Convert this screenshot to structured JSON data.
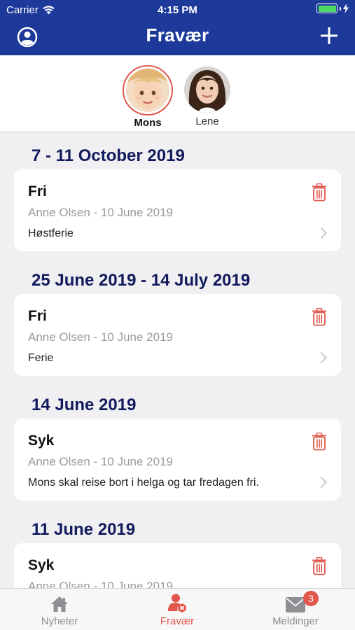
{
  "status_bar": {
    "carrier": "Carrier",
    "time": "4:15 PM"
  },
  "nav": {
    "title": "Fravær"
  },
  "children": [
    {
      "name": "Mons",
      "selected": true
    },
    {
      "name": "Lene",
      "selected": false
    }
  ],
  "absences": [
    {
      "period": "7 - 11 October 2019",
      "type": "Fri",
      "meta": "Anne Olsen - 10 June 2019",
      "description": "Høstferie"
    },
    {
      "period": "25 June 2019 - 14 July 2019",
      "type": "Fri",
      "meta": "Anne Olsen - 10 June 2019",
      "description": "Ferie"
    },
    {
      "period": "14 June 2019",
      "type": "Syk",
      "meta": "Anne Olsen - 10 June 2019",
      "description": "Mons skal reise bort i helga og tar fredagen fri."
    },
    {
      "period": "11 June 2019",
      "type": "Syk",
      "meta": "Anne Olsen - 10 June 2019",
      "description": ""
    }
  ],
  "tabs": [
    {
      "label": "Nyheter",
      "icon": "home-icon",
      "active": false
    },
    {
      "label": "Fravær",
      "icon": "absence-icon",
      "active": true
    },
    {
      "label": "Meldinger",
      "icon": "mail-icon",
      "active": false,
      "badge": "3"
    }
  ],
  "colors": {
    "header": "#1d3a9b",
    "accent": "#e2574c",
    "section_title": "#111a5c",
    "battery": "#4cd964"
  }
}
